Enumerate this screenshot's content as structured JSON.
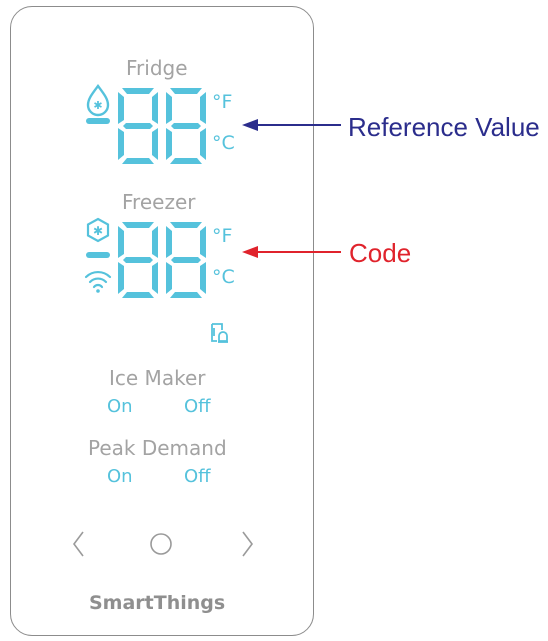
{
  "panel": {
    "fridge": {
      "label": "Fridge",
      "unit_f": "°F",
      "unit_c": "°C"
    },
    "freezer": {
      "label": "Freezer",
      "unit_f": "°F",
      "unit_c": "°C"
    },
    "ice_maker": {
      "label": "Ice Maker",
      "on": "On",
      "off": "Off"
    },
    "peak_demand": {
      "label": "Peak Demand",
      "on": "On",
      "off": "Off"
    },
    "brand": "SmartThings"
  },
  "callouts": {
    "reference": {
      "label": "Reference Value",
      "color": "#2b2d8c"
    },
    "code": {
      "label": "Code",
      "color": "#e0232c"
    }
  },
  "colors": {
    "segment": "#55c2dc",
    "label_gray": "#a3a3a3",
    "nav_gray": "#9a9a9a",
    "border": "#8c8c8c"
  },
  "icons": [
    "water-drop-icon",
    "snowflake-hexagon-icon",
    "wifi-icon",
    "door-alarm-icon",
    "chevron-left-icon",
    "home-circle-icon",
    "chevron-right-icon"
  ]
}
